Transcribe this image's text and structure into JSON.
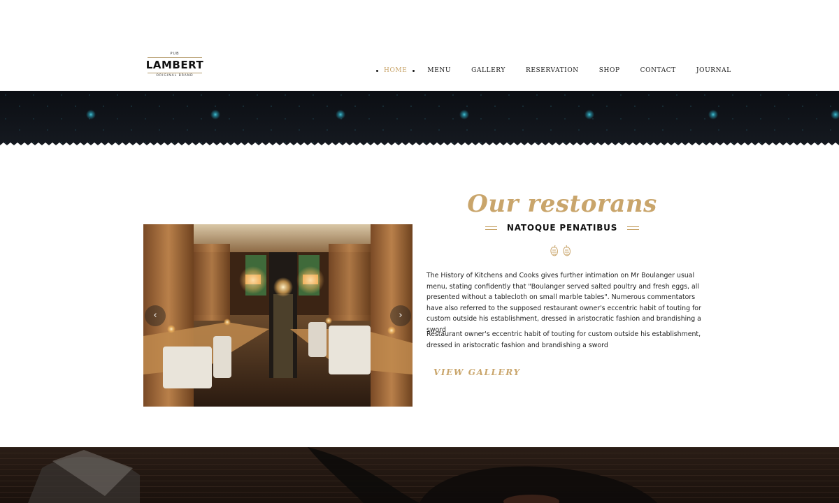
{
  "logo": {
    "top_text": "PUB",
    "name": "LAMBERT",
    "tagline": "ORIGINAL BRAND"
  },
  "nav": {
    "items": [
      {
        "label": "HOME",
        "active": true
      },
      {
        "label": "MENU"
      },
      {
        "label": "GALLERY"
      },
      {
        "label": "RESERVATION"
      },
      {
        "label": "SHOP"
      },
      {
        "label": "CONTACT"
      },
      {
        "label": "JOURNAL"
      }
    ]
  },
  "section": {
    "title": "Our restorans",
    "subtitle": "NATOQUE PENATIBUS",
    "ornament_icon": "hops-ornament-icon",
    "paragraph_1": "The History of Kitchens and Cooks gives further intimation on Mr Boulanger usual menu, stating confidently that \"Boulanger served salted poultry and fresh eggs, all presented without a tablecloth on small marble tables\". Numerous commentators have also referred to the supposed restaurant owner's eccentric habit of touting for custom outside his establishment, dressed in aristocratic fashion and brandishing a sword",
    "paragraph_2": "Restaurant owner's eccentric habit of touting for custom outside his establishment, dressed in aristocratic fashion and brandishing a sword",
    "cta": "VIEW GALLERY"
  },
  "slider": {
    "prev_glyph": "‹",
    "next_glyph": "›",
    "prev_icon": "chevron-left-icon",
    "next_icon": "chevron-right-icon"
  },
  "colors": {
    "accent": "#c9a56b",
    "dark_band": "#0e1116",
    "star": "#2fb3c9",
    "text": "#1f1f1f"
  }
}
